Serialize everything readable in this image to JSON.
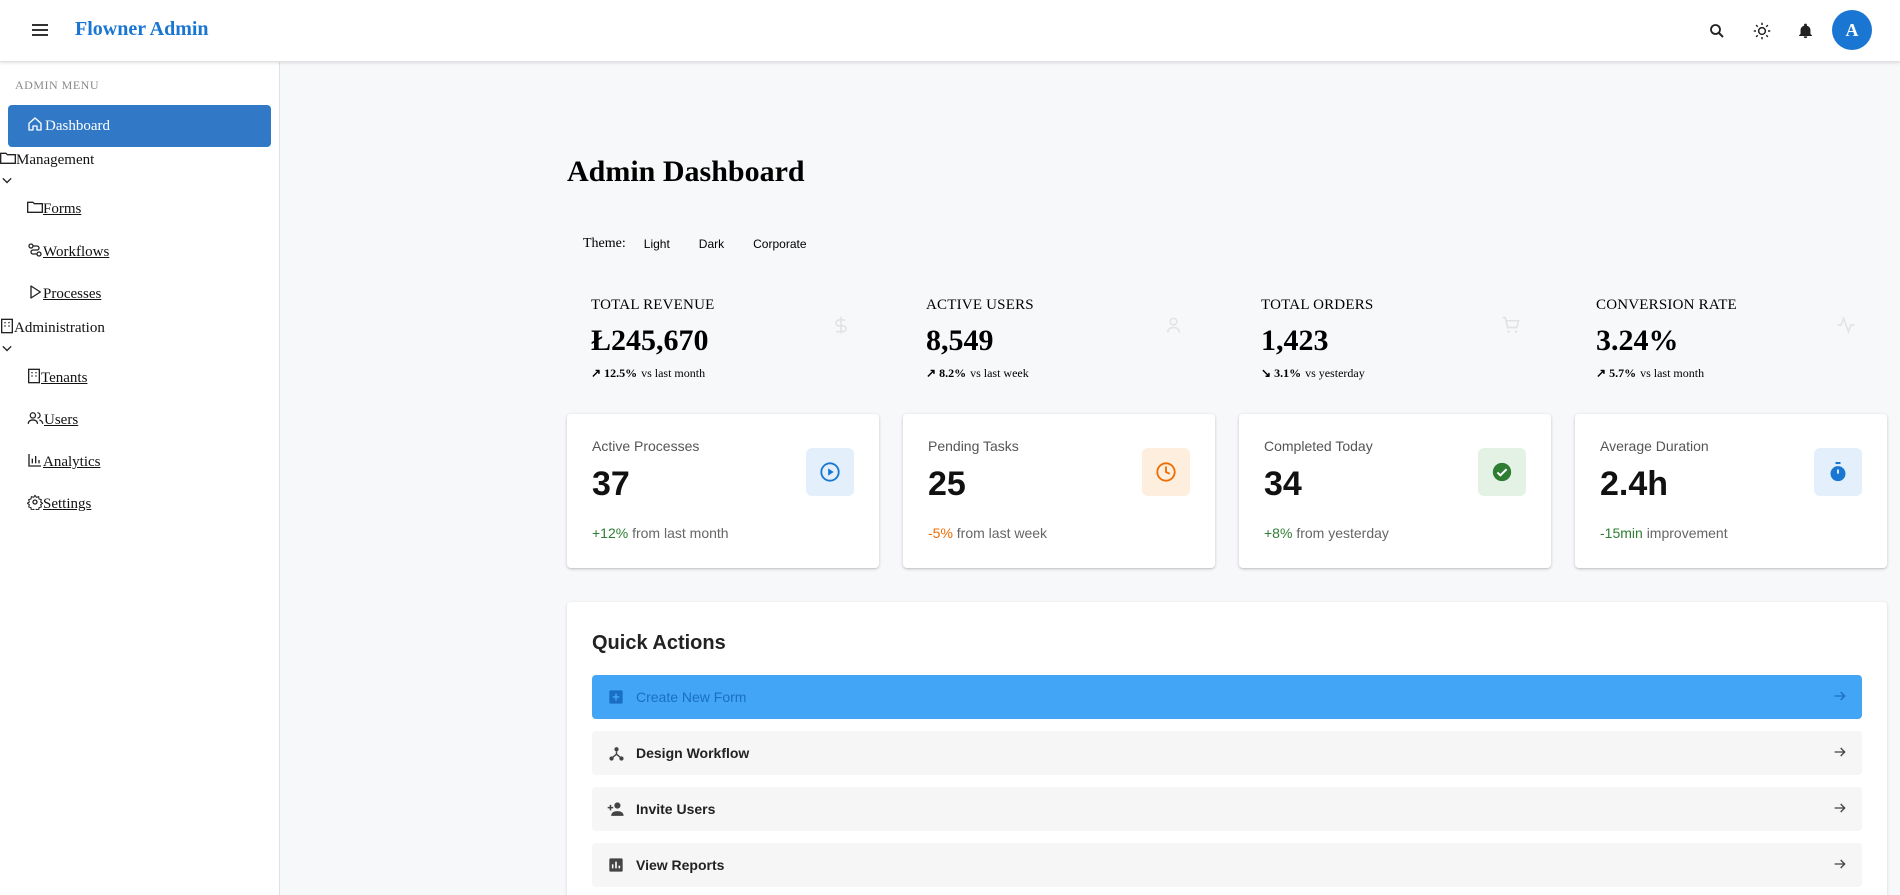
{
  "app": {
    "brand": "Flowner Admin",
    "avatar_letter": "A",
    "accent": "#1976d2"
  },
  "sidebar": {
    "section_label": "ADMIN MENU",
    "active_item": "Dashboard",
    "groups": [
      {
        "label": "Management",
        "items": [
          "Forms",
          "Workflows",
          "Processes"
        ]
      },
      {
        "label": "Administration",
        "items": [
          "Tenants",
          "Users",
          "Analytics",
          "Settings"
        ]
      }
    ]
  },
  "main": {
    "title": "Admin Dashboard",
    "theme_label": "Theme:",
    "theme_options": [
      "Light",
      "Dark",
      "Corporate"
    ]
  },
  "kpis": [
    {
      "label": "TOTAL REVENUE",
      "value": "Ł245,670",
      "trend_arrow": "↗",
      "trend": "12.5%",
      "period": "vs last month",
      "icon": "dollar-icon"
    },
    {
      "label": "ACTIVE USERS",
      "value": "8,549",
      "trend_arrow": "↗",
      "trend": "8.2%",
      "period": "vs last week",
      "icon": "users-icon"
    },
    {
      "label": "TOTAL ORDERS",
      "value": "1,423",
      "trend_arrow": "↘",
      "trend": "3.1%",
      "period": "vs yesterday",
      "icon": "cart-icon"
    },
    {
      "label": "CONVERSION RATE",
      "value": "3.24%",
      "trend_arrow": "↗",
      "trend": "5.7%",
      "period": "vs last month",
      "icon": "activity-icon"
    }
  ],
  "cards": [
    {
      "label": "Active Processes",
      "value": "37",
      "delta": "+12%",
      "delta_color": "#2e7d32",
      "suffix": "from last month",
      "icon": "play-circle-icon",
      "badge_bg": "#e3f0fc",
      "icon_color": "#1976d2"
    },
    {
      "label": "Pending Tasks",
      "value": "25",
      "delta": "-5%",
      "delta_color": "#ef6c00",
      "suffix": "from last week",
      "icon": "clock-icon",
      "badge_bg": "#fdeede",
      "icon_color": "#ef6c00"
    },
    {
      "label": "Completed Today",
      "value": "34",
      "delta": "+8%",
      "delta_color": "#2e7d32",
      "suffix": "from yesterday",
      "icon": "check-circle-icon",
      "badge_bg": "#e4f2e5",
      "icon_color": "#2e7d32"
    },
    {
      "label": "Average Duration",
      "value": "2.4h",
      "delta": "-15min",
      "delta_color": "#2e7d32",
      "suffix": "improvement",
      "icon": "timer-icon",
      "badge_bg": "#e3f0fc",
      "icon_color": "#1976d2"
    }
  ],
  "quick_actions": {
    "title": "Quick Actions",
    "items": [
      {
        "label": "Create New Form",
        "icon": "add-box-icon"
      },
      {
        "label": "Design Workflow",
        "icon": "workflow-icon"
      },
      {
        "label": "Invite Users",
        "icon": "person-add-icon"
      },
      {
        "label": "View Reports",
        "icon": "bar-chart-icon"
      }
    ]
  }
}
